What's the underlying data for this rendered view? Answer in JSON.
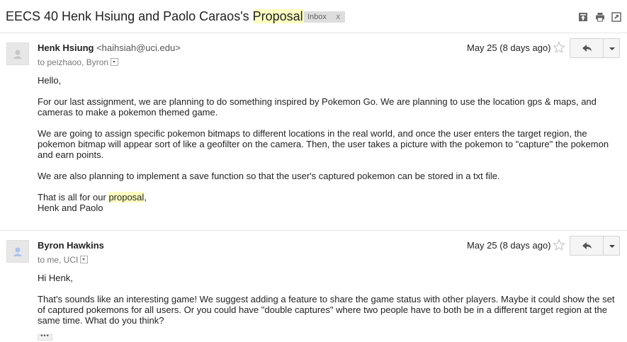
{
  "thread": {
    "subject_prefix": "EECS 40 Henk Hsiung and Paolo Caraos's ",
    "subject_highlight": "Proposal",
    "label": "Inbox",
    "label_remove": "x"
  },
  "messages": [
    {
      "sender_name": "Henk Hsiung",
      "sender_email": "<haihsiah@uci.edu>",
      "recipients": "to peizhaoo, Byron",
      "date": "May 25 (8 days ago)",
      "paragraphs": [
        "Hello,",
        "For our last assignment, we are planning to do something inspired by Pokemon Go. We are planning to use the location gps & maps, and cameras to make a pokemon themed game.",
        "We are going to assign specific pokemon bitmaps to different locations in the real world, and once the user enters the target region, the pokemon bitmap will appear sort of like a geofilter on the camera. Then, the user takes a picture with the pokemon to \"capture\" the pokemon and earn points.",
        "We are also planning to implement a save function so that the user's captured pokemon can be stored in a txt file."
      ],
      "closing_prefix": "That is all for our ",
      "closing_highlight": "proposal",
      "closing_suffix": ",",
      "signature": "Henk and Paolo"
    },
    {
      "sender_name": "Byron Hawkins",
      "recipients": "to me, UCI",
      "date": "May 25 (8 days ago)",
      "paragraphs": [
        "Hi Henk,",
        "That's sounds like an interesting game! We suggest adding a feature to share the game status with other players. Maybe it could show the set of captured pokemons for all users. Or you could have \"double captures\" where two people have to both be in a different target region at the same time. What do you think?"
      ],
      "trimmed_content": "•••"
    }
  ],
  "colors": {
    "highlight": "#ffffc0",
    "label_bg": "#dddddd",
    "avatar_blue": "#a9c3ee"
  }
}
